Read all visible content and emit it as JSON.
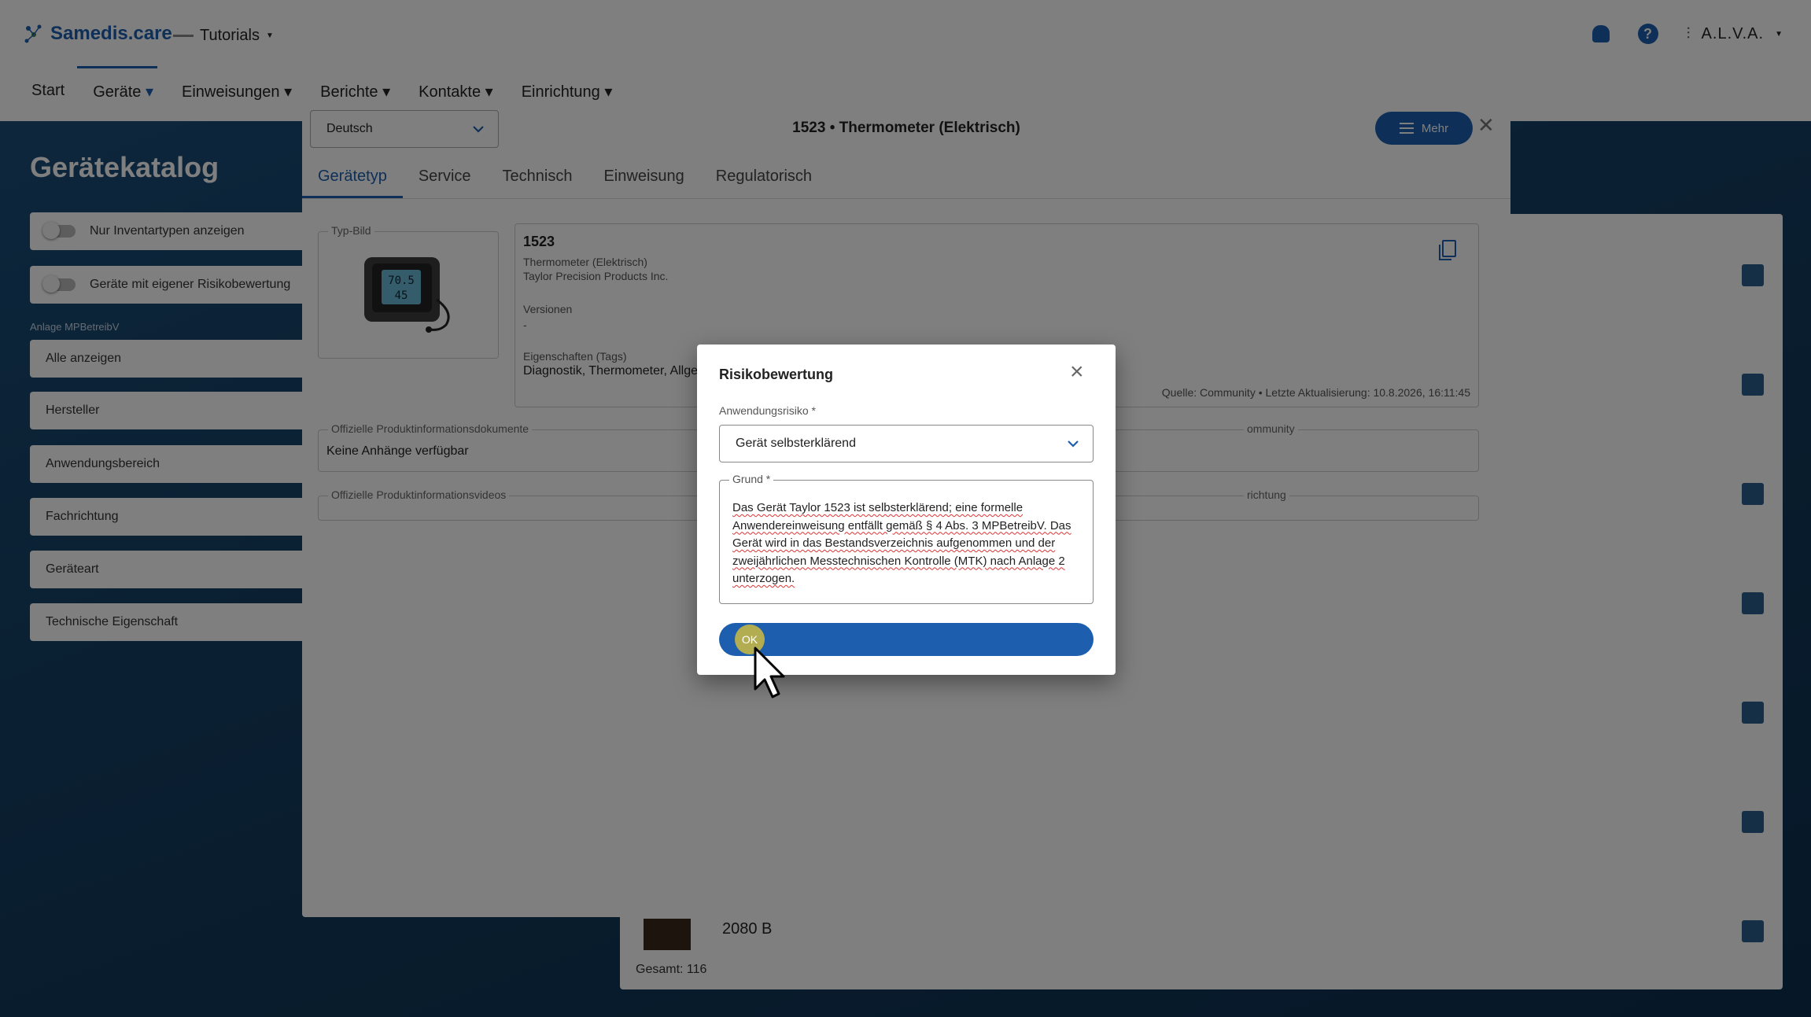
{
  "app": {
    "brand": "Samedis.care",
    "workspace": "Tutorials",
    "user": "A.L.V.A."
  },
  "nav": {
    "items": [
      "Start",
      "Geräte",
      "Einweisungen",
      "Berichte",
      "Kontakte",
      "Einrichtung"
    ]
  },
  "catalog": {
    "title": "Gerätekatalog",
    "toggles": [
      "Nur Inventartypen anzeigen",
      "Geräte mit eigener Risikobewertung"
    ],
    "anlage_caption": "Anlage MPBetreibV",
    "filters": [
      "Alle anzeigen",
      "Hersteller",
      "Anwendungsbereich",
      "Fachrichtung",
      "Geräteart",
      "Technische Eigenschaft"
    ],
    "partial_item_name": "2080 B",
    "total": "Gesamt: 116"
  },
  "modal": {
    "language": "Deutsch",
    "title": "1523 • Thermometer (Elektrisch)",
    "more_label": "Mehr",
    "tabs": [
      "Gerätetyp",
      "Service",
      "Technisch",
      "Einweisung",
      "Regulatorisch"
    ],
    "image_legend": "Typ-Bild",
    "device": {
      "number": "1523",
      "type": "Thermometer (Elektrisch)",
      "manufacturer": "Taylor Precision Products Inc.",
      "versions_label": "Versionen",
      "versions_value": "-",
      "tags_label": "Eigenschaften (Tags)",
      "tags_value": "Diagnostik, Thermometer, Allge",
      "source": "Quelle: Community • Letzte Aktualisierung: 10.8.2026, 16:11:45"
    },
    "docs_legend": "Offizielle Produktinformationsdokumente",
    "docs_value": "Keine Anhänge verfügbar",
    "community_legend": "ommunity",
    "videos_legend": "Offizielle Produktinformationsvideos",
    "videos_right_legend": "richtung"
  },
  "dialog": {
    "title": "Risikobewertung",
    "risk_label": "Anwendungsrisiko *",
    "risk_value": "Gerät selbsterklärend",
    "reason_label": "Grund *",
    "reason_text": "Das Gerät Taylor 1523 ist selbsterklärend; eine formelle Anwendereinweisung entfällt gemäß § 4 Abs. 3 MPBetreibV. Das Gerät wird in das Bestandsverzeichnis aufgenommen und der zweijährlichen Messtechnischen Kontrolle (MTK) nach Anlage 2 unterzogen.",
    "ok_label": "OK"
  },
  "colors": {
    "brand": "#1d5fae",
    "backdrop": "#0f2d47"
  },
  "icons": [
    "bell-icon",
    "help-icon",
    "user-icon",
    "chevron-down-icon",
    "menu-icon",
    "close-icon",
    "copy-icon",
    "cursor-icon"
  ]
}
